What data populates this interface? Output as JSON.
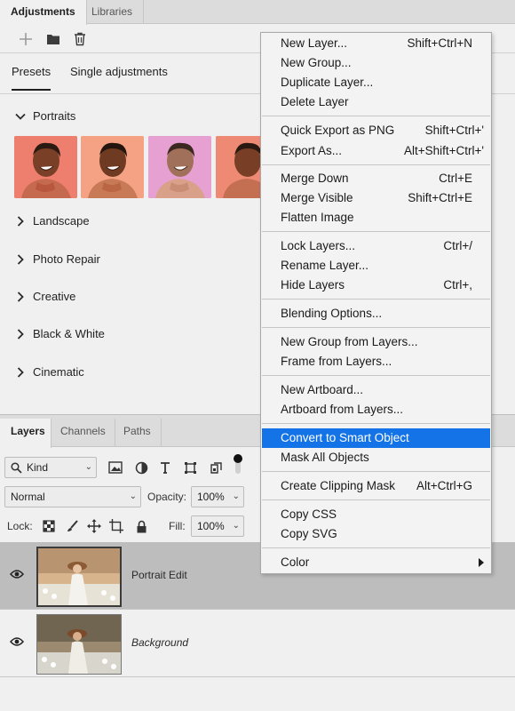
{
  "adjustments": {
    "tabs": [
      "Adjustments",
      "Libraries"
    ],
    "subtabs": [
      "Presets",
      "Single adjustments"
    ],
    "groups": [
      "Portraits",
      "Landscape",
      "Photo Repair",
      "Creative",
      "Black & White",
      "Cinematic"
    ],
    "toolbar_icons": [
      "add-icon",
      "folder-icon",
      "trash-icon"
    ]
  },
  "layers_panel": {
    "tabs": [
      "Layers",
      "Channels",
      "Paths"
    ],
    "filter": {
      "kind_label": "Kind"
    },
    "blend_mode": "Normal",
    "opacity_label": "Opacity:",
    "opacity_value": "100%",
    "lock_label": "Lock:",
    "fill_label": "Fill:",
    "fill_value": "100%",
    "layers": [
      {
        "name": "Portrait Edit",
        "selected": true,
        "italic": false
      },
      {
        "name": "Background",
        "selected": false,
        "italic": true
      }
    ]
  },
  "context_menu": {
    "highlight_color": "#1473e6",
    "items": [
      {
        "label": "New Layer...",
        "shortcut": "Shift+Ctrl+N"
      },
      {
        "label": "New Group...",
        "shortcut": ""
      },
      {
        "label": "Duplicate Layer...",
        "shortcut": ""
      },
      {
        "label": "Delete Layer",
        "shortcut": ""
      },
      {
        "label": "Quick Export as PNG",
        "shortcut": "Shift+Ctrl+'"
      },
      {
        "label": "Export As...",
        "shortcut": "Alt+Shift+Ctrl+'"
      },
      {
        "label": "Merge Down",
        "shortcut": "Ctrl+E"
      },
      {
        "label": "Merge Visible",
        "shortcut": "Shift+Ctrl+E"
      },
      {
        "label": "Flatten Image",
        "shortcut": ""
      },
      {
        "label": "Lock Layers...",
        "shortcut": "Ctrl+/"
      },
      {
        "label": "Rename Layer...",
        "shortcut": ""
      },
      {
        "label": "Hide Layers",
        "shortcut": "Ctrl+,"
      },
      {
        "label": "Blending Options...",
        "shortcut": ""
      },
      {
        "label": "New Group from Layers...",
        "shortcut": ""
      },
      {
        "label": "Frame from Layers...",
        "shortcut": ""
      },
      {
        "label": "New Artboard...",
        "shortcut": ""
      },
      {
        "label": "Artboard from Layers...",
        "shortcut": ""
      },
      {
        "label": "Convert to Smart Object",
        "shortcut": "",
        "highlighted": true
      },
      {
        "label": "Mask All Objects",
        "shortcut": ""
      },
      {
        "label": "Create Clipping Mask",
        "shortcut": "Alt+Ctrl+G"
      },
      {
        "label": "Copy CSS",
        "shortcut": ""
      },
      {
        "label": "Copy SVG",
        "shortcut": ""
      },
      {
        "label": "Color",
        "shortcut": "",
        "submenu": true
      }
    ]
  }
}
